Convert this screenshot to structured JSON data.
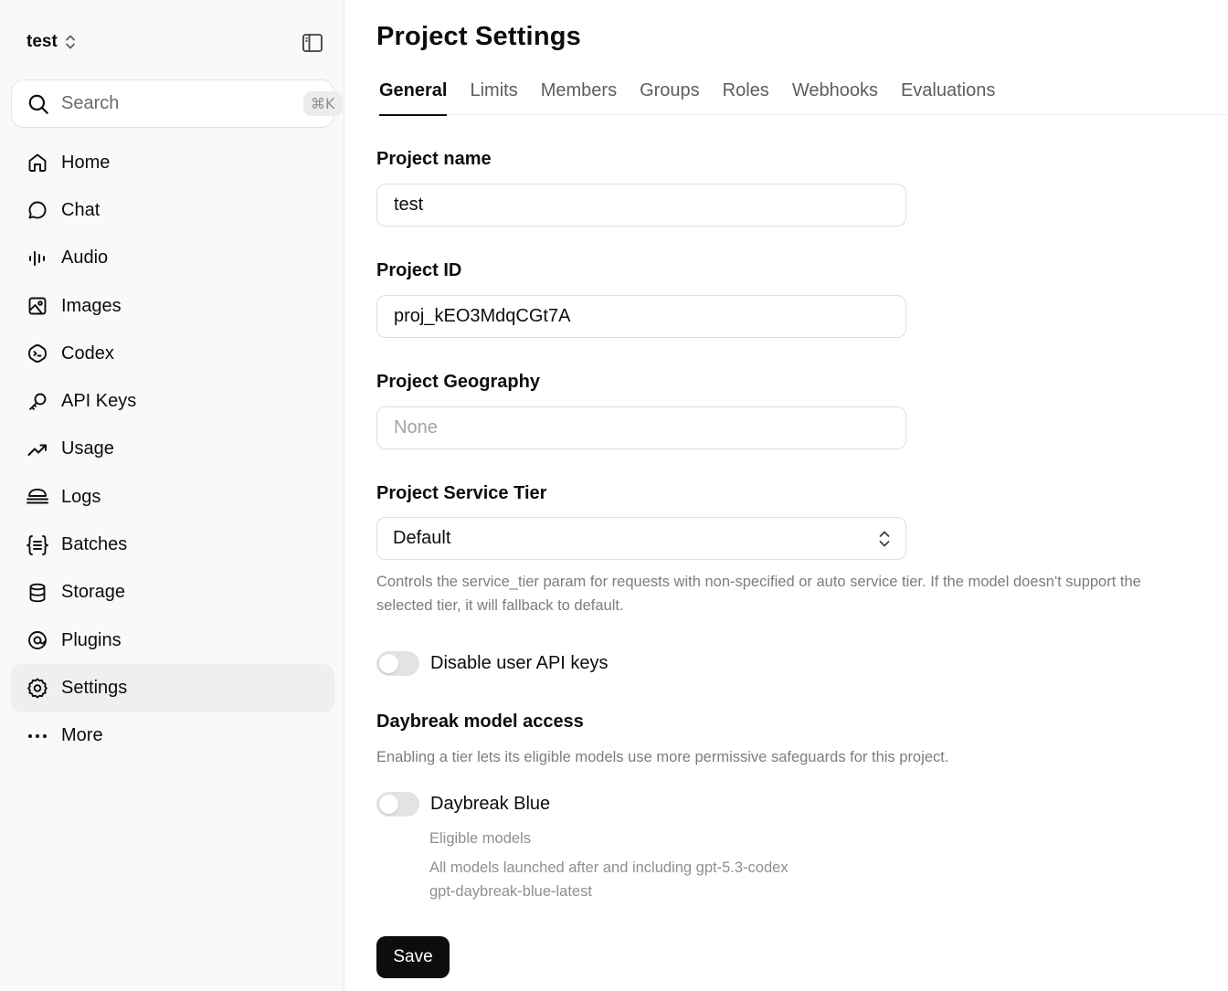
{
  "sidebar": {
    "project_name": "test",
    "search": {
      "placeholder": "Search",
      "shortcut": "⌘K"
    },
    "items": [
      {
        "label": "Home",
        "icon": "home-icon"
      },
      {
        "label": "Chat",
        "icon": "chat-icon"
      },
      {
        "label": "Audio",
        "icon": "audio-icon"
      },
      {
        "label": "Images",
        "icon": "images-icon"
      },
      {
        "label": "Codex",
        "icon": "codex-icon"
      },
      {
        "label": "API Keys",
        "icon": "key-icon"
      },
      {
        "label": "Usage",
        "icon": "usage-icon"
      },
      {
        "label": "Logs",
        "icon": "logs-icon"
      },
      {
        "label": "Batches",
        "icon": "batches-icon"
      },
      {
        "label": "Storage",
        "icon": "storage-icon"
      },
      {
        "label": "Plugins",
        "icon": "plugins-icon"
      },
      {
        "label": "Settings",
        "icon": "gear-icon",
        "active": true
      },
      {
        "label": "More",
        "icon": "more-icon"
      }
    ]
  },
  "main": {
    "title": "Project Settings",
    "tabs": [
      {
        "label": "General",
        "active": true
      },
      {
        "label": "Limits"
      },
      {
        "label": "Members"
      },
      {
        "label": "Groups"
      },
      {
        "label": "Roles"
      },
      {
        "label": "Webhooks"
      },
      {
        "label": "Evaluations"
      }
    ],
    "project_name": {
      "label": "Project name",
      "value": "test"
    },
    "project_id": {
      "label": "Project ID",
      "value": "proj_kEO3MdqCGt7A"
    },
    "project_geography": {
      "label": "Project Geography",
      "placeholder": "None"
    },
    "service_tier": {
      "label": "Project Service Tier",
      "selected": "Default",
      "help": "Controls the service_tier param for requests with non-specified or auto service tier. If the model doesn't support the selected tier, it will fallback to default."
    },
    "disable_user_keys": {
      "label": "Disable user API keys",
      "enabled": false
    },
    "daybreak": {
      "heading": "Daybreak model access",
      "description": "Enabling a tier lets its eligible models use more permissive safeguards for this project.",
      "blue": {
        "label": "Daybreak Blue",
        "enabled": false,
        "eligible_label": "Eligible models",
        "models_line1": "All models launched after and including gpt-5.3-codex",
        "models_line2": "gpt-daybreak-blue-latest"
      }
    },
    "save_label": "Save"
  },
  "colors": {
    "primary_button": "#0d0d0d",
    "sidebar_bg": "#f9f9f9",
    "active_nav": "#efefef"
  }
}
